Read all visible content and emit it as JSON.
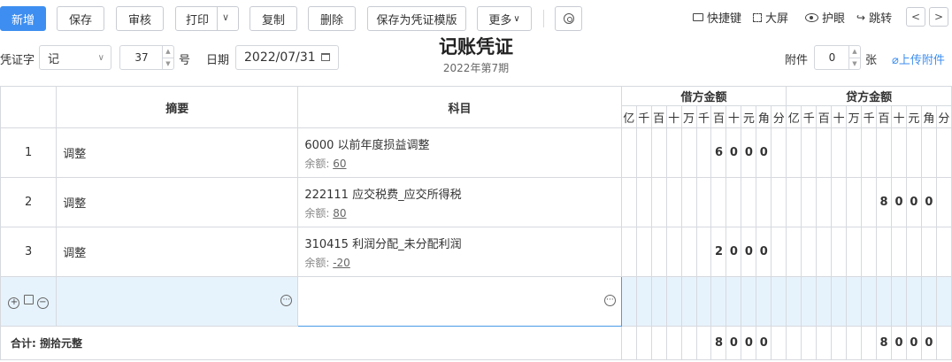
{
  "toolbar": {
    "new": "新增",
    "save": "保存",
    "audit": "审核",
    "print": "打印",
    "copy": "复制",
    "delete": "删除",
    "save_template": "保存为凭证模版",
    "more": "更多",
    "shortcut": "快捷键",
    "bigscreen": "大屏",
    "eyecare": "护眼",
    "jump": "跳转"
  },
  "header": {
    "title": "记账凭证",
    "period": "2022年第7期",
    "voucher_type_label": "凭证字",
    "voucher_type_value": "记",
    "number_value": "37",
    "number_unit": "号",
    "date_label": "日期",
    "date_value": "2022/07/31",
    "attach_label": "附件",
    "attach_value": "0",
    "attach_unit": "张",
    "upload": "上传附件"
  },
  "table": {
    "col_summary": "摘要",
    "col_subject": "科目",
    "col_debit": "借方金额",
    "col_credit": "贷方金额",
    "digits": [
      "亿",
      "千",
      "百",
      "十",
      "万",
      "千",
      "百",
      "十",
      "元",
      "角",
      "分"
    ],
    "rows": [
      {
        "idx": "1",
        "summary": "调整",
        "subject": "6000  以前年度损益调整",
        "balance_label": "余额:",
        "balance": "60",
        "debit": [
          "",
          "",
          "",
          "",
          "",
          "",
          "6",
          "0",
          "0",
          "0",
          ""
        ],
        "credit": [
          "",
          "",
          "",
          "",
          "",
          "",
          "",
          "",
          "",
          "",
          ""
        ]
      },
      {
        "idx": "2",
        "summary": "调整",
        "subject": "222111  应交税费_应交所得税",
        "balance_label": "余额:",
        "balance": "80",
        "debit": [
          "",
          "",
          "",
          "",
          "",
          "",
          "",
          "",
          "",
          "",
          ""
        ],
        "credit": [
          "",
          "",
          "",
          "",
          "",
          "",
          "8",
          "0",
          "0",
          "0",
          ""
        ]
      },
      {
        "idx": "3",
        "summary": "调整",
        "subject": "310415  利润分配_未分配利润",
        "balance_label": "余额:",
        "balance": "-20",
        "debit": [
          "",
          "",
          "",
          "",
          "",
          "",
          "2",
          "0",
          "0",
          "0",
          ""
        ],
        "credit": [
          "",
          "",
          "",
          "",
          "",
          "",
          "",
          "",
          "",
          "",
          ""
        ]
      }
    ],
    "total_label": "合计: 捌拾元整",
    "total_debit": [
      "",
      "",
      "",
      "",
      "",
      "",
      "8",
      "0",
      "0",
      "0",
      ""
    ],
    "total_credit": [
      "",
      "",
      "",
      "",
      "",
      "",
      "8",
      "0",
      "0",
      "0",
      ""
    ]
  }
}
